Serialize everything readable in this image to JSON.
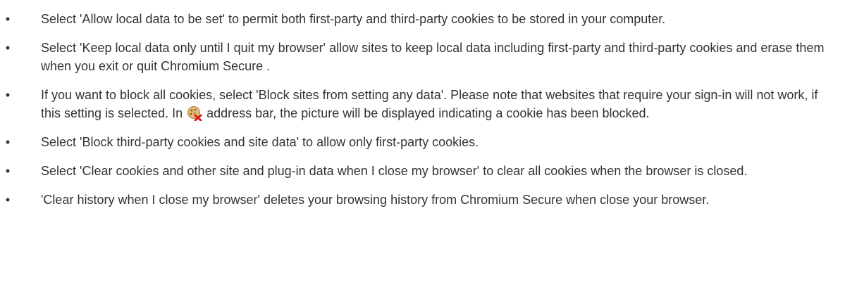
{
  "bullet_symbol": "•",
  "items": [
    {
      "text": "Select 'Allow local data to be set' to permit both first-party and third-party cookies to be stored in your computer."
    },
    {
      "text": "Select 'Keep local data only until I quit my browser' allow sites to keep local data including first-party and third-party cookies and erase them when you exit or quit Chromium Secure ."
    },
    {
      "text_before_icon": "If you want to block all cookies, select 'Block sites from setting any data'. Please note that websites that require your sign-in will not work, if this setting is selected. In ",
      "icon": "blocked-cookie-icon",
      "text_after_icon": " address bar, the picture will be displayed indicating a cookie has been blocked."
    },
    {
      "text": "Select 'Block third-party cookies and site data' to allow only first-party cookies."
    },
    {
      "text": "Select 'Clear cookies and other site and plug-in data when I close my browser' to clear all cookies when the browser is closed."
    },
    {
      "text": "'Clear history when I close my browser' deletes your browsing history from Chromium Secure  when close your browser."
    }
  ],
  "colors": {
    "text": "#333333",
    "cookie": "#d9a35a",
    "blocked_x": "#d81e1e"
  }
}
